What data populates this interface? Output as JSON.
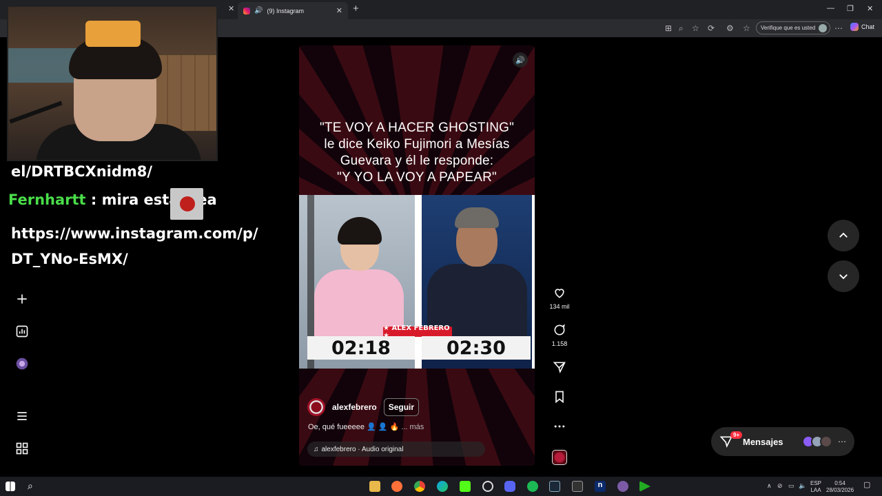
{
  "browser": {
    "tab_title": "(9) Instagram",
    "verify_label": "Verifique que es usted",
    "chat_label": "Chat"
  },
  "overlay": {
    "line1": "el/DRTBCXnidm8/",
    "user": "Fernhartt",
    "message": "mira esta wea",
    "line3": "https://www.instagram.com/p/",
    "line4": "DT_YNo-EsMX/"
  },
  "reel": {
    "caption_lines": [
      "\"TE VOY A HACER GHOSTING\"",
      "le dice Keiko Fujimori a Mesías",
      "Guevara y él le responde:",
      "\"Y YO LA VOY A PAPEAR\""
    ],
    "timer_left": "02:18",
    "timer_right": "02:30",
    "brand": "★ ALEX FEBRERO ★",
    "author": "alexfebrero",
    "follow_label": "Seguir",
    "description": "Oe, qué fueeeee",
    "more_label": "... más",
    "audio_label": "alexfebrero · Audio original"
  },
  "actions": {
    "likes": "134 mil",
    "comments": "1.158"
  },
  "messages": {
    "label": "Mensajes",
    "badge": "9+"
  },
  "taskbar": {
    "lang_top": "ESP",
    "lang_bottom": "LAA",
    "time": "0:54",
    "date": "28/03/2026"
  }
}
